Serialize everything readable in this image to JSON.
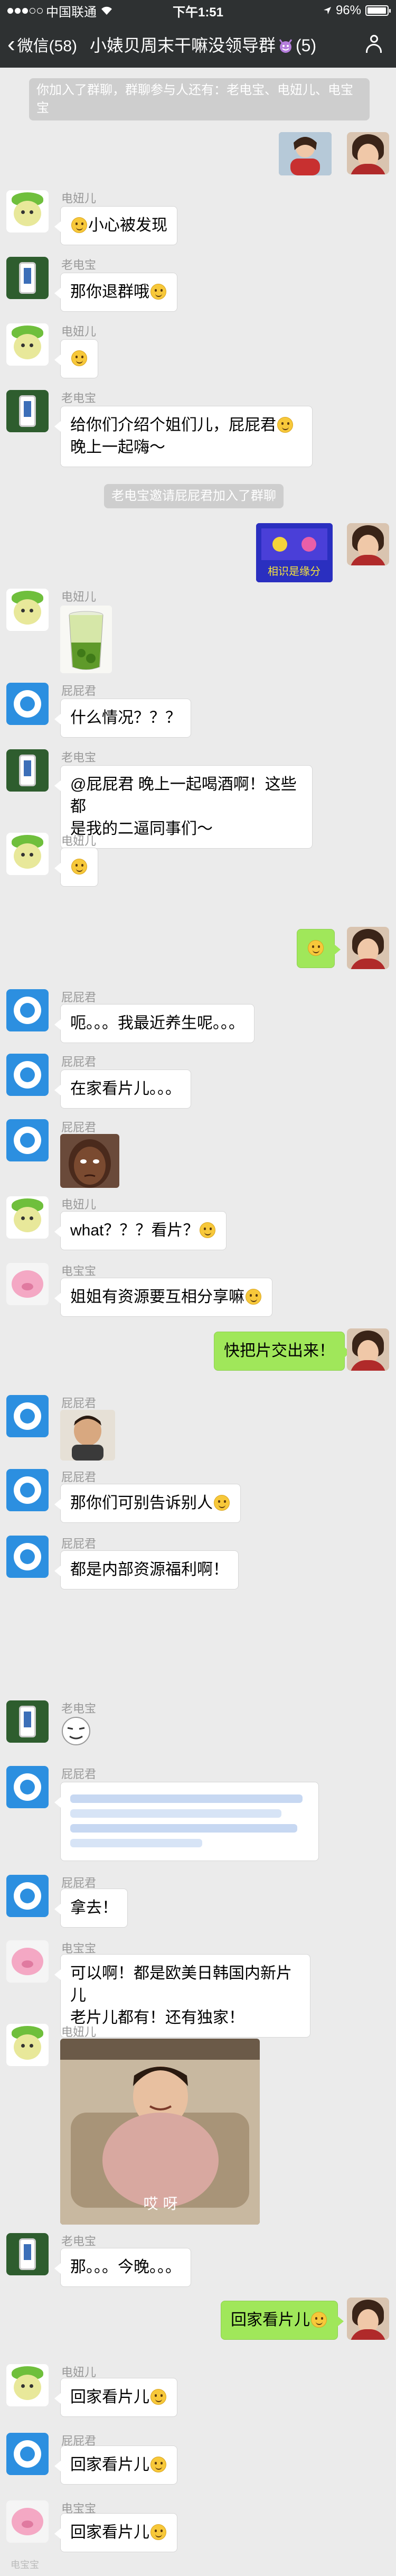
{
  "status_bar": {
    "carrier": "中国联通",
    "time": "下午1:51",
    "battery": "96%",
    "battery_level": 0.96
  },
  "nav": {
    "back_label": "微信(58)",
    "title": "小婊贝周末干嘛没领导群",
    "member_count": "(5)"
  },
  "chat": {
    "sys1": "你加入了群聊，群聊参与人还有：老电宝、电妞儿、电宝宝",
    "sys2": "老电宝邀请屁屁君加入了群聊",
    "names": {
      "dianniu": "电妞儿",
      "laodianbao": "老电宝",
      "pipijun": "屁屁君",
      "dianbaobao": "电宝宝"
    },
    "m1": "小心被发现",
    "m2": "那你退群哦",
    "m3_a": "给你们介绍个姐们儿，屁屁君",
    "m3_b": "晚上一起嗨～",
    "m4": "什么情况？？？",
    "m5_a": "@屁屁君 晚上一起喝酒啊！这些都",
    "m5_b": "是我的二逼同事们～",
    "m6": "呃。。。我最近养生呢。。。",
    "m7": "在家看片儿。。。",
    "m8": "what？？？看片？",
    "m9": "姐姐有资源要互相分享嘛",
    "m10": "快把片交出来！",
    "m11": "那你们可别告诉别人",
    "m12": "都是内部资源福利啊！",
    "m13": "拿去！",
    "m14_a": "可以啊！都是欧美日韩国内新片儿",
    "m14_b": "老片儿都有！还有独家！",
    "gif_caption": "哎 呀",
    "m15": "那。。。今晚。。。",
    "m16": "回家看片儿",
    "m17": "回家看片儿",
    "m18": "回家看片儿",
    "m19": "回家看片儿",
    "sticker_text": "相识是缘分"
  },
  "watermark": "电宝宝"
}
